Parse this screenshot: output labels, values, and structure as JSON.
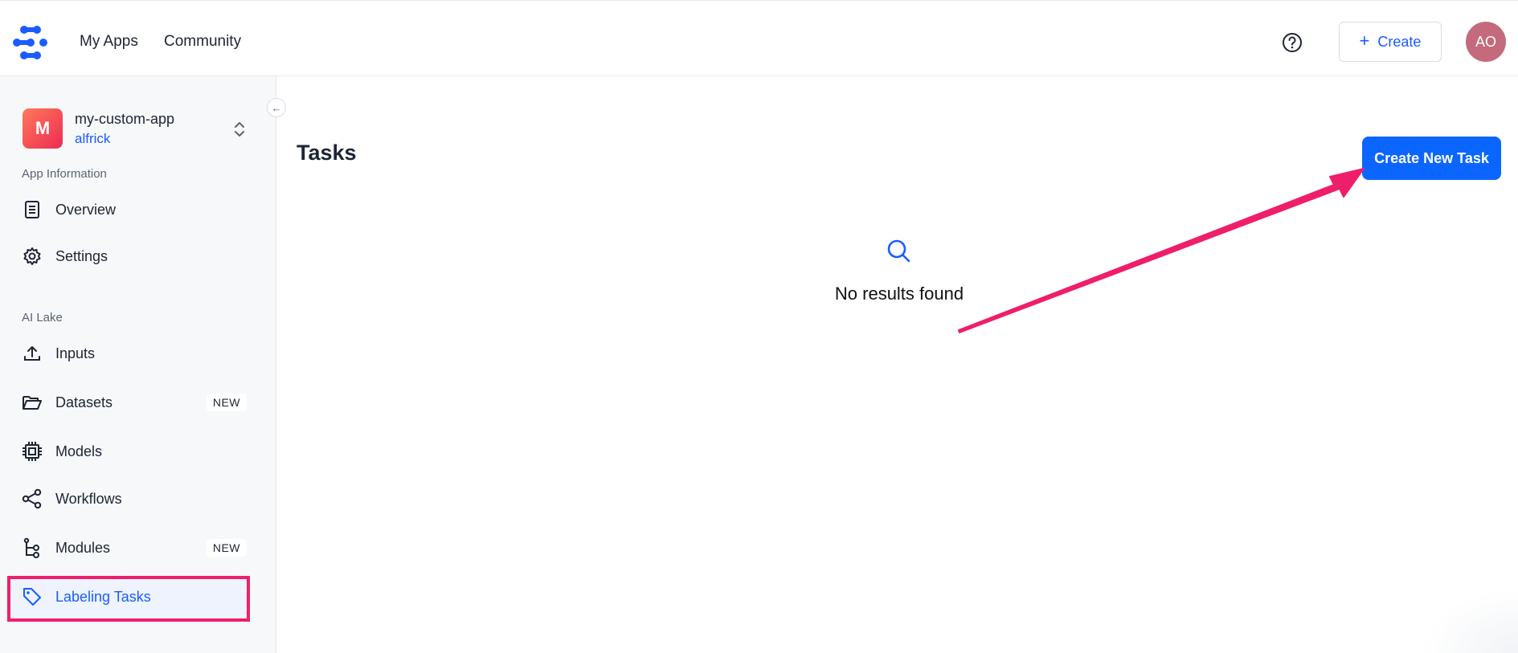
{
  "header": {
    "logo_icon": "clarifai-logo-icon",
    "nav": [
      {
        "label": "My Apps"
      },
      {
        "label": "Community"
      }
    ],
    "help_icon": "help-circle-icon",
    "create_label": "Create",
    "avatar_initials": "AO",
    "avatar_color": "#c46a7c"
  },
  "sidebar": {
    "app": {
      "badge_letter": "M",
      "name": "my-custom-app",
      "owner": "alfrick"
    },
    "sections": {
      "app_information": "App Information",
      "ai_lake": "AI Lake"
    },
    "items": [
      {
        "label": "Overview",
        "icon": "document-icon"
      },
      {
        "label": "Settings",
        "icon": "gear-icon"
      },
      {
        "label": "Inputs",
        "icon": "upload-icon"
      },
      {
        "label": "Datasets",
        "icon": "folder-open-icon",
        "badge": "NEW"
      },
      {
        "label": "Models",
        "icon": "chip-icon"
      },
      {
        "label": "Workflows",
        "icon": "share-nodes-icon"
      },
      {
        "label": "Modules",
        "icon": "branch-icon",
        "badge": "NEW"
      },
      {
        "label": "Labeling Tasks",
        "icon": "tag-icon",
        "active": true
      }
    ]
  },
  "main": {
    "title": "Tasks",
    "create_task_label": "Create New Task",
    "empty_icon": "search-icon",
    "empty_text": "No results found"
  },
  "colors": {
    "accent": "#1a5cff",
    "primary_button": "#0a66ff",
    "highlight": "#ef1e6b"
  }
}
